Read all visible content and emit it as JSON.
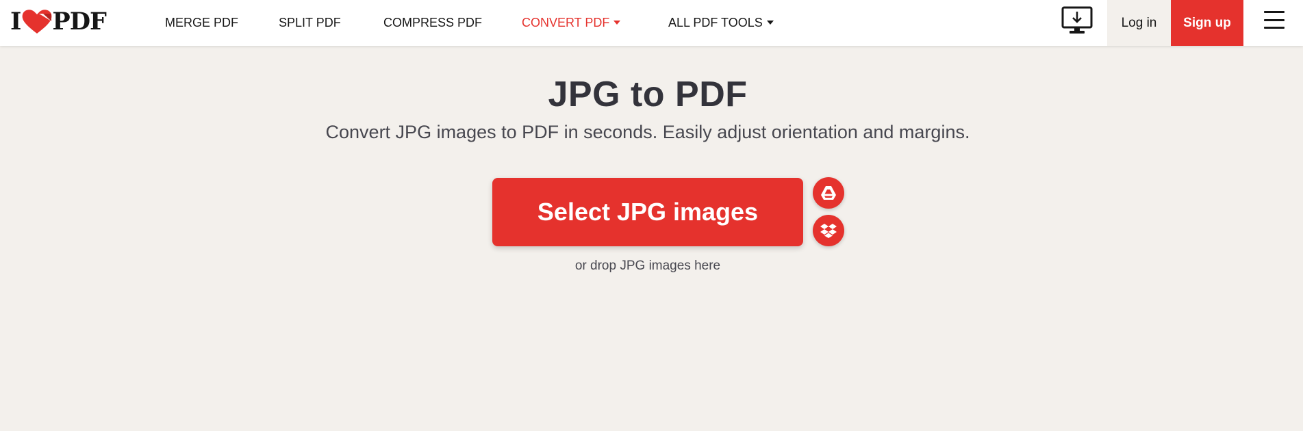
{
  "header": {
    "logo": {
      "text_left": "I",
      "text_right": "PDF"
    },
    "nav": [
      {
        "label": "MERGE PDF",
        "active": false,
        "dropdown": false
      },
      {
        "label": "SPLIT PDF",
        "active": false,
        "dropdown": false
      },
      {
        "label": "COMPRESS PDF",
        "active": false,
        "dropdown": false
      },
      {
        "label": "CONVERT PDF",
        "active": true,
        "dropdown": true
      },
      {
        "label": "ALL PDF TOOLS",
        "active": false,
        "dropdown": true
      }
    ],
    "desktop_icon": "desktop-download-icon",
    "login_label": "Log in",
    "signup_label": "Sign up",
    "menu_icon": "hamburger-menu-icon"
  },
  "main": {
    "title": "JPG to PDF",
    "subtitle": "Convert JPG images to PDF in seconds. Easily adjust orientation and margins.",
    "select_button_label": "Select JPG images",
    "cloud_buttons": [
      {
        "icon": "google-drive-icon"
      },
      {
        "icon": "dropbox-icon"
      }
    ],
    "drop_hint": "or drop JPG images here"
  },
  "colors": {
    "brand_red": "#e5322d",
    "page_background": "#f3f0ec",
    "header_background": "#ffffff",
    "text_dark": "#33333b"
  }
}
